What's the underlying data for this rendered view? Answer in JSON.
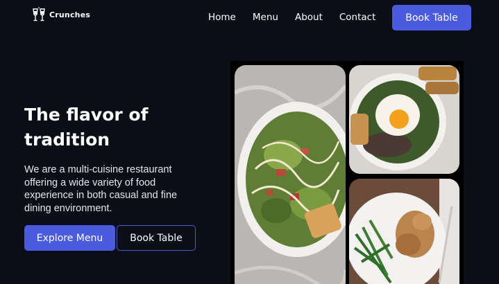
{
  "brand": {
    "name": "Crunches",
    "logo_icon": "toast-glasses-icon"
  },
  "nav": {
    "items": [
      "Home",
      "Menu",
      "About",
      "Contact"
    ]
  },
  "header": {
    "cta_label": "Book Table"
  },
  "hero": {
    "title": "The flavor of tradition",
    "description": "We are a multi-cuisine restaurant offering a wide variety of food experience in both casual and fine dining environment.",
    "primary_button": "Explore Menu",
    "secondary_button": "Book Table"
  },
  "gallery": {
    "images": [
      "caesar-salad-photo",
      "egg-rice-bowl-photo",
      "chicken-green-beans-photo"
    ]
  },
  "colors": {
    "background": "#0b0e17",
    "accent": "#4b5be0",
    "text": "#ffffff"
  }
}
